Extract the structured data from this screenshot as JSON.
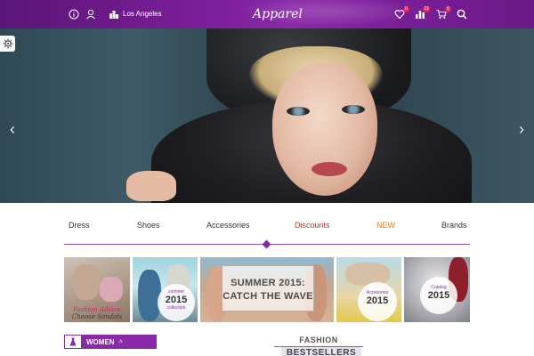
{
  "header": {
    "city": "Los Angeles",
    "logo": "Apparel",
    "icons": [
      "info-icon",
      "user-icon",
      "city-icon",
      "heart-icon",
      "compare-icon",
      "cart-icon",
      "search-icon"
    ],
    "badges": {
      "wishlist": "0",
      "compare": "12",
      "cart": "0"
    }
  },
  "hero": {
    "slide_count": 4,
    "active_slide": 1,
    "icons": [
      "arrow-left-icon",
      "arrow-right-icon",
      "gear-icon"
    ]
  },
  "nav": {
    "items": [
      {
        "label": "Dress",
        "color": "#333333"
      },
      {
        "label": "Shoes",
        "color": "#333333"
      },
      {
        "label": "Accessories",
        "color": "#333333"
      },
      {
        "label": "Discounts",
        "color": "#c0392b"
      },
      {
        "label": "NEW",
        "color": "#e67e22"
      },
      {
        "label": "Brands",
        "color": "#333333"
      }
    ]
  },
  "banners": {
    "advice": {
      "line1": "Fashion Advice",
      "line2": "Choose Sandals"
    },
    "summer": {
      "small_top": "summer",
      "year": "2015",
      "small_bottom": "collection"
    },
    "wave": {
      "line1": "SUMMER 2015:",
      "line2": "CATCH THE WAVE"
    },
    "accessories": {
      "small_top": "Accesories",
      "year": "2015"
    },
    "catalog": {
      "small_top": "Catalog",
      "year": "2015"
    }
  },
  "sidebar": {
    "women_label": "WOMEN"
  },
  "bestsellers": {
    "line1": "FASHION",
    "line2": "BESTSELLERS"
  },
  "colors": {
    "brand": "#8a2aa8",
    "accent": "#e0245e"
  }
}
